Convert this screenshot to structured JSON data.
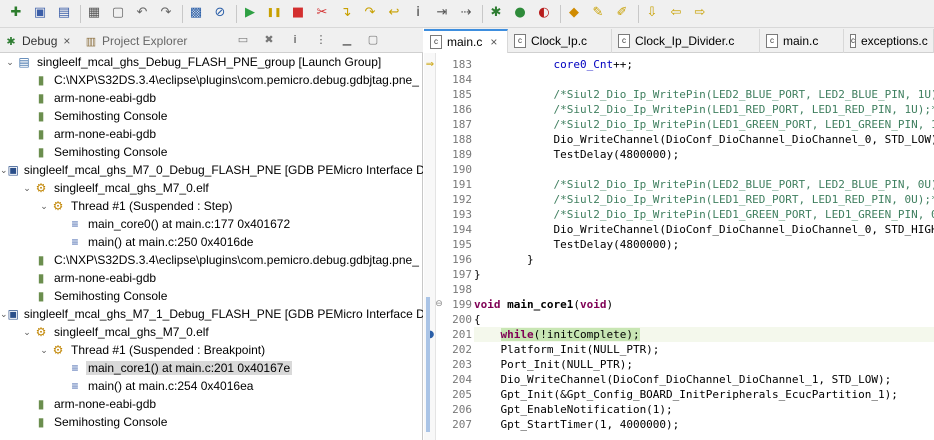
{
  "toolbar": {
    "icons": [
      "new-icon",
      "save-icon",
      "save-all-icon",
      "build-icon",
      "sdk-icon",
      "undo-icon",
      "redo-icon",
      "config-tools-icon",
      "breakpoint-skip-icon",
      "resume-icon",
      "suspend-icon",
      "terminate-icon",
      "disconnect-icon",
      "step-into-icon",
      "step-over-icon",
      "step-return-icon",
      "instruction-step-icon",
      "drop-to-frame-icon",
      "use-step-filters-icon",
      "debug-menu-icon",
      "run-icon",
      "external-tools-icon",
      "open-type-icon",
      "search-icon",
      "pen-icon",
      "annotation-icon",
      "back-icon",
      "forward-icon"
    ]
  },
  "left_panel": {
    "tabs": [
      {
        "label": "Debug",
        "icon": "debug-bug-icon",
        "close": "×",
        "active": true
      },
      {
        "label": "Project Explorer",
        "icon": "project-explorer-icon",
        "active": false
      }
    ],
    "tree": [
      {
        "indent": 0,
        "twisty": "open",
        "icon": "launch-group-icon",
        "label": "singleelf_mcal_ghs_Debug_FLASH_PNE_group [Launch Group]"
      },
      {
        "indent": 1,
        "twisty": "",
        "icon": "process-icon",
        "label": "C:\\NXP\\S32DS.3.4\\eclipse\\plugins\\com.pemicro.debug.gdbjtag.pne_"
      },
      {
        "indent": 1,
        "twisty": "",
        "icon": "process-icon",
        "label": "arm-none-eabi-gdb"
      },
      {
        "indent": 1,
        "twisty": "",
        "icon": "process-icon",
        "label": "Semihosting Console"
      },
      {
        "indent": 1,
        "twisty": "",
        "icon": "process-icon",
        "label": "arm-none-eabi-gdb"
      },
      {
        "indent": 1,
        "twisty": "",
        "icon": "process-icon",
        "label": "Semihosting Console"
      },
      {
        "indent": 0,
        "twisty": "open",
        "icon": "gdb-launch-icon",
        "label": "singleelf_mcal_ghs_M7_0_Debug_FLASH_PNE [GDB PEMicro Interface De"
      },
      {
        "indent": 1,
        "twisty": "open",
        "icon": "debug-target-icon",
        "label": "singleelf_mcal_ghs_M7_0.elf"
      },
      {
        "indent": 2,
        "twisty": "open",
        "icon": "thread-suspended-icon",
        "label": "Thread #1 (Suspended : Step)"
      },
      {
        "indent": 3,
        "twisty": "",
        "icon": "stack-frame-icon",
        "label": "main_core0() at main.c:177 0x401672",
        "selected": false
      },
      {
        "indent": 3,
        "twisty": "",
        "icon": "stack-frame-icon",
        "label": "main() at main.c:250 0x4016de"
      },
      {
        "indent": 1,
        "twisty": "",
        "icon": "process-icon",
        "label": "C:\\NXP\\S32DS.3.4\\eclipse\\plugins\\com.pemicro.debug.gdbjtag.pne_"
      },
      {
        "indent": 1,
        "twisty": "",
        "icon": "process-icon",
        "label": "arm-none-eabi-gdb"
      },
      {
        "indent": 1,
        "twisty": "",
        "icon": "process-icon",
        "label": "Semihosting Console"
      },
      {
        "indent": 0,
        "twisty": "open",
        "icon": "gdb-launch-icon",
        "label": "singleelf_mcal_ghs_M7_1_Debug_FLASH_PNE [GDB PEMicro Interface De"
      },
      {
        "indent": 1,
        "twisty": "open",
        "icon": "debug-target-icon",
        "label": "singleelf_mcal_ghs_M7_0.elf"
      },
      {
        "indent": 2,
        "twisty": "open",
        "icon": "thread-suspended-icon",
        "label": "Thread #1 (Suspended : Breakpoint)"
      },
      {
        "indent": 3,
        "twisty": "",
        "icon": "stack-frame-icon",
        "label": "main_core1() at main.c:201 0x40167e",
        "selected": true
      },
      {
        "indent": 3,
        "twisty": "",
        "icon": "stack-frame-icon",
        "label": "main() at main.c:254 0x4016ea"
      },
      {
        "indent": 1,
        "twisty": "",
        "icon": "process-icon",
        "label": "arm-none-eabi-gdb"
      },
      {
        "indent": 1,
        "twisty": "",
        "icon": "process-icon",
        "label": "Semihosting Console"
      }
    ]
  },
  "editor": {
    "tabs": [
      {
        "label": "main.c",
        "close": "×",
        "active": true
      },
      {
        "label": "Clock_Ip.c",
        "active": false
      },
      {
        "label": "Clock_Ip_Divider.c",
        "active": false
      },
      {
        "label": "main.c",
        "active": false
      },
      {
        "label": "exceptions.c",
        "active": false
      }
    ],
    "lines": [
      {
        "n": "183",
        "code": "            core0_Cnt++;",
        "kind": "var",
        "marker": "arrow"
      },
      {
        "n": "184",
        "code": "",
        "kind": "plain"
      },
      {
        "n": "185",
        "code": "            /*Siul2_Dio_Ip_WritePin(LED2_BLUE_PORT, LED2_BLUE_PIN, 1U)",
        "kind": "comment"
      },
      {
        "n": "186",
        "code": "            /*Siul2_Dio_Ip_WritePin(LED1_RED_PORT, LED1_RED_PIN, 1U);*",
        "kind": "comment"
      },
      {
        "n": "187",
        "code": "            /*Siul2_Dio_Ip_WritePin(LED1_GREEN_PORT, LED1_GREEN_PIN, 1",
        "kind": "comment"
      },
      {
        "n": "188",
        "code": "            Dio_WriteChannel(DioConf_DioChannel_DioChannel_0, STD_LOW)",
        "kind": "plain"
      },
      {
        "n": "189",
        "code": "            TestDelay(4800000);",
        "kind": "plain"
      },
      {
        "n": "190",
        "code": "",
        "kind": "plain"
      },
      {
        "n": "191",
        "code": "            /*Siul2_Dio_Ip_WritePin(LED2_BLUE_PORT, LED2_BLUE_PIN, 0U)",
        "kind": "comment"
      },
      {
        "n": "192",
        "code": "            /*Siul2_Dio_Ip_WritePin(LED1_RED_PORT, LED1_RED_PIN, 0U);*",
        "kind": "comment"
      },
      {
        "n": "193",
        "code": "            /*Siul2_Dio_Ip_WritePin(LED1_GREEN_PORT, LED1_GREEN_PIN, 0",
        "kind": "comment"
      },
      {
        "n": "194",
        "code": "            Dio_WriteChannel(DioConf_DioChannel_DioChannel_0, STD_HIGH",
        "kind": "plain"
      },
      {
        "n": "195",
        "code": "            TestDelay(4800000);",
        "kind": "plain"
      },
      {
        "n": "196",
        "code": "        }",
        "kind": "plain"
      },
      {
        "n": "197",
        "code": "}",
        "kind": "plain"
      },
      {
        "n": "198",
        "code": "",
        "kind": "plain"
      },
      {
        "n": "199",
        "code": "void main_core1(void)",
        "kind": "decl",
        "fold": "⊖"
      },
      {
        "n": "200",
        "code": "{",
        "kind": "plain"
      },
      {
        "n": "201",
        "code": "    while(!initComplete);",
        "kind": "current",
        "marker": "breakpoint-arrow"
      },
      {
        "n": "202",
        "code": "    Platform_Init(NULL_PTR);",
        "kind": "plain"
      },
      {
        "n": "203",
        "code": "    Port_Init(NULL_PTR);",
        "kind": "plain"
      },
      {
        "n": "204",
        "code": "    Dio_WriteChannel(DioConf_DioChannel_DioChannel_1, STD_LOW);",
        "kind": "plain"
      },
      {
        "n": "205",
        "code": "    Gpt_Init(&Gpt_Config_BOARD_InitPeripherals_EcucPartition_1);",
        "kind": "plain"
      },
      {
        "n": "206",
        "code": "    Gpt_EnableNotification(1);",
        "kind": "plain"
      },
      {
        "n": "207",
        "code": "    Gpt_StartTimer(1, 4000000);",
        "kind": "plain"
      }
    ]
  },
  "colors": {
    "accent": "#3e8ede",
    "comment": "#3f7f5f",
    "keyword": "#7f0055",
    "variable": "#0000c0",
    "current_line_highlight": "#c8e6b4",
    "selection": "#d9d9d9"
  }
}
